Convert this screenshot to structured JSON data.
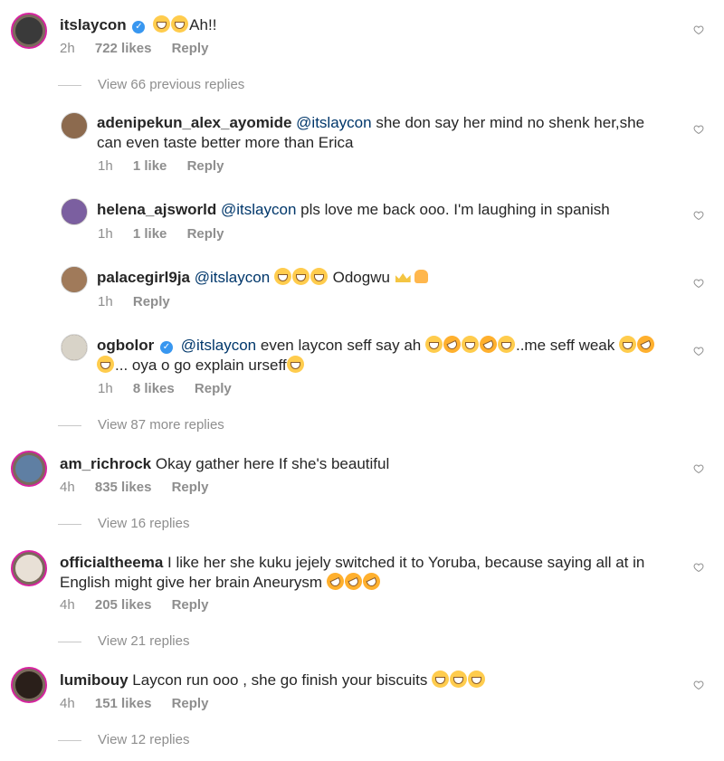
{
  "comments": [
    {
      "id": "c1",
      "user": "itslaycon",
      "verified": true,
      "pre_emoji": [
        "laugh",
        "laugh"
      ],
      "text": "Ah!!",
      "time": "2h",
      "likes": "722 likes",
      "reply": "Reply",
      "view_more": "View 66 previous replies"
    },
    {
      "id": "r1",
      "user": "adenipekun_alex_ayomide",
      "mention": "@itslaycon",
      "text": "she don say her mind no shenk her,she",
      "text2": "can even taste better more than Erica",
      "time": "1h",
      "likes": "1 like",
      "reply": "Reply"
    },
    {
      "id": "r2",
      "user": "helena_ajsworld",
      "mention": "@itslaycon",
      "text": "pls love me back ooo. I'm laughing in spanish",
      "time": "1h",
      "likes": "1 like",
      "reply": "Reply"
    },
    {
      "id": "r3",
      "user": "palacegirl9ja",
      "mention": "@itslaycon",
      "text": "Odogwu",
      "time": "1h",
      "reply": "Reply"
    },
    {
      "id": "r4",
      "user": "ogbolor",
      "verified": true,
      "mention": "@itslaycon",
      "text": "even laycon seff say ah",
      "text_mid": "..me seff weak",
      "text2": "... oya o go explain urseff",
      "time": "1h",
      "likes": "8 likes",
      "reply": "Reply",
      "view_more": "View 87 more replies"
    },
    {
      "id": "c2",
      "user": "am_richrock",
      "text": "Okay gather  here If she's beautiful",
      "time": "4h",
      "likes": "835 likes",
      "reply": "Reply",
      "view_more": "View 16 replies"
    },
    {
      "id": "c3",
      "user": "officialtheema",
      "text": "I like her she kuku jejely switched it to Yoruba, because saying all at in",
      "text2": "English might give her brain Aneurysm",
      "time": "4h",
      "likes": "205 likes",
      "reply": "Reply",
      "view_more": "View 21 replies"
    },
    {
      "id": "c4",
      "user": "lumibouy",
      "text": "Laycon run ooo , she go finish your biscuits",
      "time": "4h",
      "likes": "151 likes",
      "reply": "Reply",
      "view_more": "View 12 replies"
    }
  ],
  "icons": {
    "heart": "heart-outline-icon",
    "verified": "verified-badge-icon"
  },
  "colors": {
    "mention": "#00376b",
    "meta": "#8e8e8e",
    "verified": "#3897f0",
    "story_ring": "#d6249f"
  }
}
